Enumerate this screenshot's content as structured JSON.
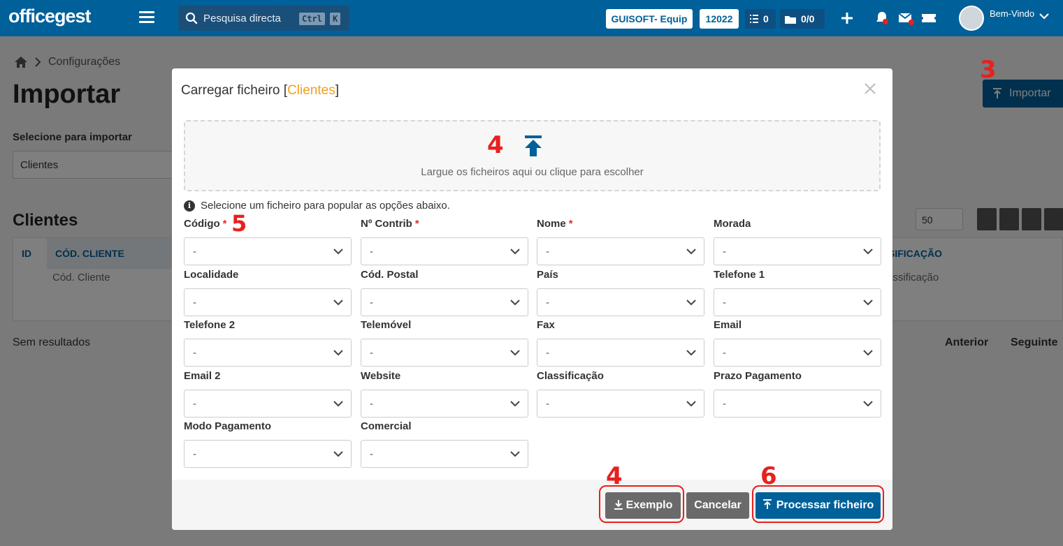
{
  "navbar": {
    "logo": "officegest",
    "search_placeholder": "Pesquisa directa",
    "kbd_ctrl": "Ctrl",
    "kbd_k": "K",
    "company": "GUISOFT- Equip",
    "year": "12022",
    "tasks_count": "0",
    "folders_count": "0/0",
    "welcome": "Bem-Vindo"
  },
  "page": {
    "breadcrumb_item": "Configurações",
    "title": "Importar",
    "select_label": "Selecione para importar",
    "select_value": "Clientes",
    "import_button": "Importar",
    "section_title": "Clientes",
    "col_id": "ID",
    "col_cod": "CÓD. CLIENTE",
    "col_class": "SIFICAÇÃO",
    "filter_cod": "Cód. Cliente",
    "filter_class": "assificação",
    "page_size": "50",
    "no_results": "Sem resultados",
    "prev": "Anterior",
    "next": "Seguinte"
  },
  "modal": {
    "title_prefix": "Carregar ficheiro [",
    "title_accent": "Clientes",
    "title_suffix": "]",
    "dropzone_text": "Largue os ficheiros aqui ou clique para escolher",
    "info_text": "Selecione um ficheiro para popular as opções abaixo.",
    "fields": [
      {
        "label": "Código",
        "required": "*",
        "value": "-"
      },
      {
        "label": "Nº Contrib",
        "required": "*",
        "value": "-"
      },
      {
        "label": "Nome",
        "required": "*",
        "value": "-"
      },
      {
        "label": "Morada",
        "required": "",
        "value": "-"
      },
      {
        "label": "Localidade",
        "required": "",
        "value": "-"
      },
      {
        "label": "Cód. Postal",
        "required": "",
        "value": "-"
      },
      {
        "label": "País",
        "required": "",
        "value": "-"
      },
      {
        "label": "Telefone 1",
        "required": "",
        "value": "-"
      },
      {
        "label": "Telefone 2",
        "required": "",
        "value": "-"
      },
      {
        "label": "Telemóvel",
        "required": "",
        "value": "-"
      },
      {
        "label": "Fax",
        "required": "",
        "value": "-"
      },
      {
        "label": "Email",
        "required": "",
        "value": "-"
      },
      {
        "label": "Email 2",
        "required": "",
        "value": "-"
      },
      {
        "label": "Website",
        "required": "",
        "value": "-"
      },
      {
        "label": "Classificação",
        "required": "",
        "value": "-"
      },
      {
        "label": "Prazo Pagamento",
        "required": "",
        "value": "-"
      },
      {
        "label": "Modo Pagamento",
        "required": "",
        "value": "-"
      },
      {
        "label": "Comercial",
        "required": "",
        "value": "-"
      }
    ],
    "btn_example": "Exemplo",
    "btn_cancel": "Cancelar",
    "btn_process": "Processar ficheiro"
  },
  "annotations": {
    "step3": "3",
    "step4_drop": "4",
    "step5": "5",
    "step4_example": "4",
    "step6": "6"
  },
  "colors": {
    "brand": "#00609a",
    "accent": "#f0a020",
    "annotation": "#e8201e"
  }
}
